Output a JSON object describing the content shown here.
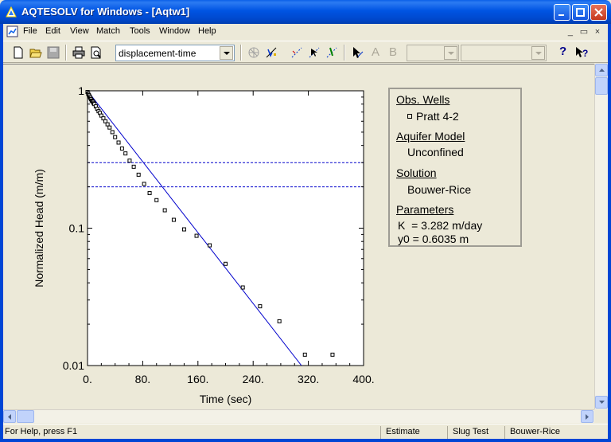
{
  "window": {
    "title": "AQTESOLV for Windows - [Aqtw1]"
  },
  "menu": {
    "items": [
      "File",
      "Edit",
      "View",
      "Match",
      "Tools",
      "Window",
      "Help"
    ],
    "mdi_buttons": [
      "_",
      "▭",
      "×"
    ]
  },
  "toolbar": {
    "plot_type_select": "displacement-time",
    "disabled_letter_a": "A",
    "disabled_letter_b": "B"
  },
  "legend": {
    "obs_wells_heading": "Obs. Wells",
    "obs_well": "Pratt 4-2",
    "aquifer_model_heading": "Aquifer Model",
    "aquifer_model": "Unconfined",
    "solution_heading": "Solution",
    "solution": "Bouwer-Rice",
    "parameters_heading": "Parameters",
    "param_k": "K  = 3.282 m/day",
    "param_y0": "y0 = 0.6035 m"
  },
  "status": {
    "help": "For Help, press F1",
    "mode": "Estimate",
    "test_type": "Slug Test",
    "method": "Bouwer-Rice"
  },
  "colors": {
    "line": "#0000CC",
    "marker": "#000000",
    "title_bar": "#0054E3"
  },
  "chart_data": {
    "type": "scatter",
    "xlabel": "Time (sec)",
    "ylabel": "Normalized Head (m/m)",
    "xlim": [
      0,
      400
    ],
    "ylim": [
      0.01,
      1
    ],
    "y_scale": "log",
    "x_ticks": [
      "0.",
      "80.",
      "160.",
      "240.",
      "320.",
      "400."
    ],
    "y_ticks": [
      "1",
      "0.1",
      "0.01"
    ],
    "observations": {
      "x": [
        0,
        1,
        2,
        3,
        4,
        5,
        6,
        7,
        8,
        9,
        10,
        12,
        14,
        16,
        18,
        20,
        23,
        26,
        29,
        32,
        36,
        40,
        45,
        50,
        55,
        61,
        67,
        74,
        82,
        90,
        100,
        112,
        125,
        140,
        158,
        177,
        200,
        225,
        250,
        278,
        315,
        355
      ],
      "y": [
        0.98,
        0.95,
        0.93,
        0.91,
        0.89,
        0.87,
        0.85,
        0.84,
        0.83,
        0.81,
        0.8,
        0.77,
        0.74,
        0.71,
        0.69,
        0.66,
        0.63,
        0.6,
        0.57,
        0.54,
        0.5,
        0.46,
        0.42,
        0.38,
        0.35,
        0.31,
        0.28,
        0.245,
        0.21,
        0.18,
        0.16,
        0.135,
        0.115,
        0.098,
        0.088,
        0.075,
        0.055,
        0.037,
        0.027,
        0.021,
        0.012,
        0.012
      ]
    },
    "fit_line": {
      "x": [
        0,
        310
      ],
      "y": [
        1.0,
        0.01
      ]
    },
    "reference_lines_y": [
      0.3,
      0.2
    ]
  }
}
